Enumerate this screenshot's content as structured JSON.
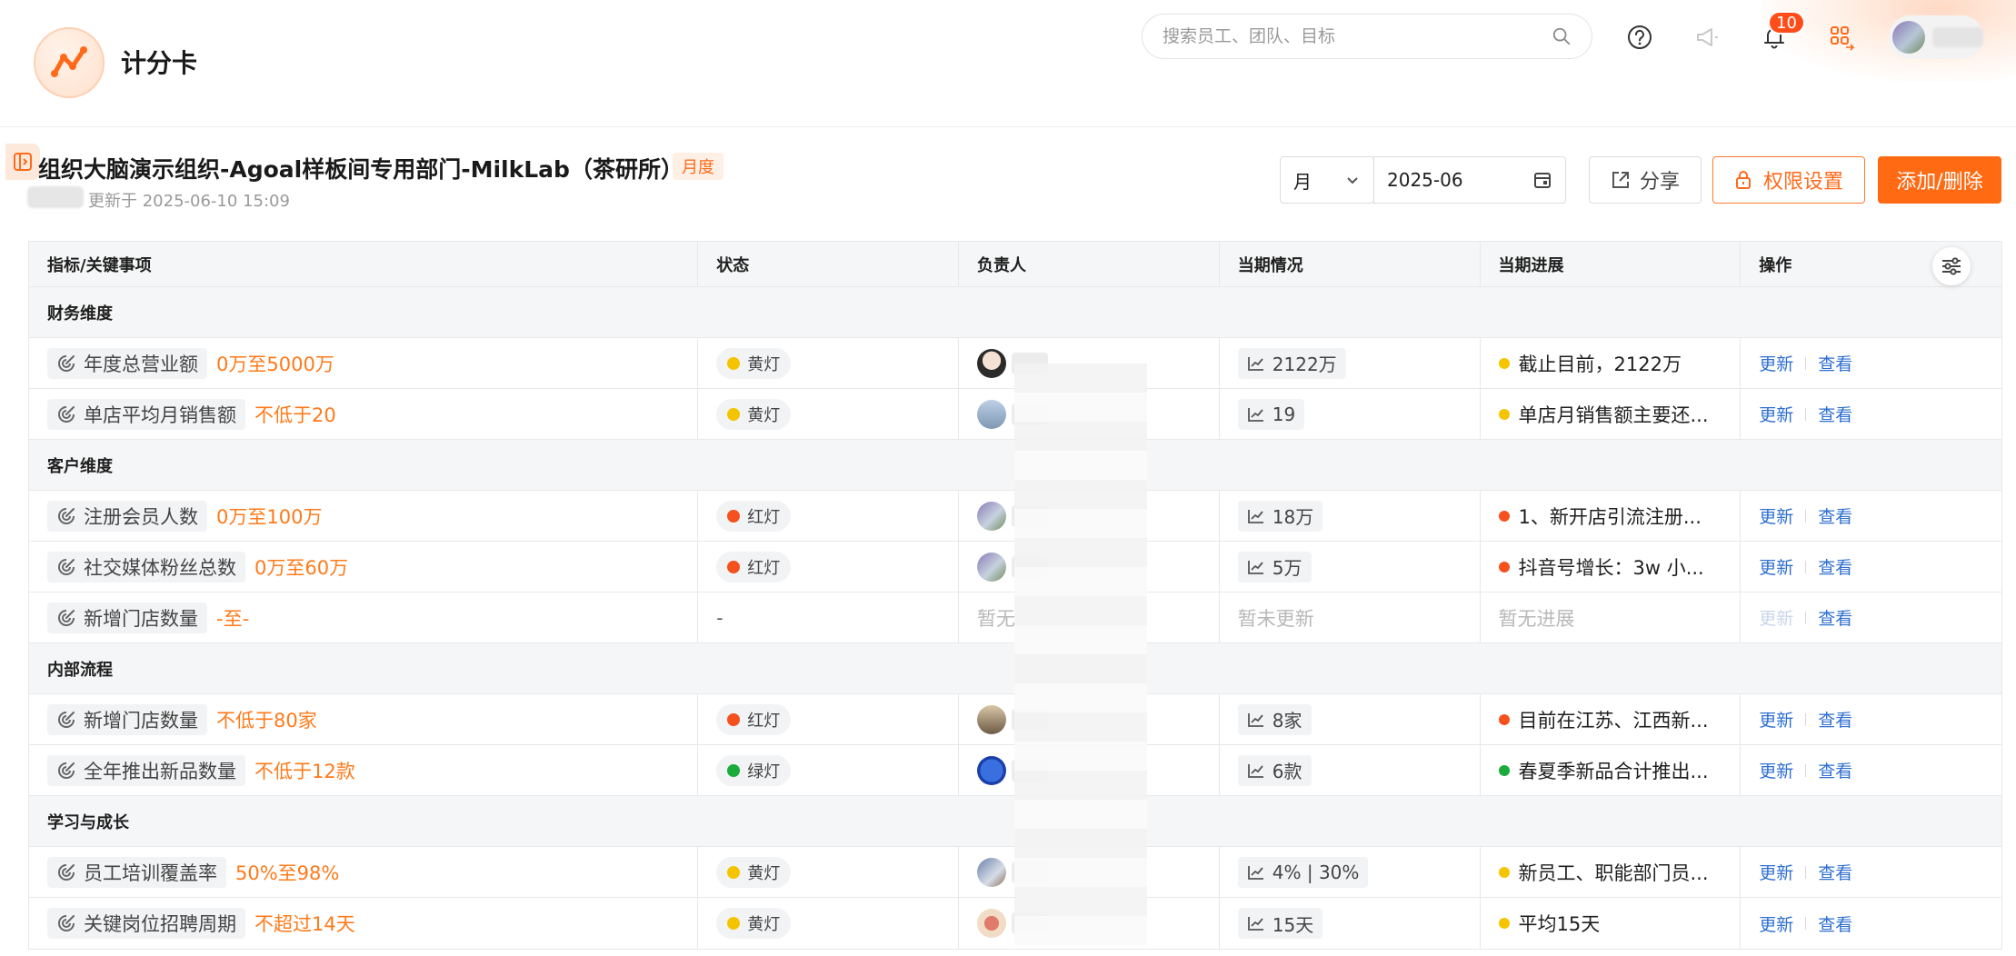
{
  "app": {
    "title": "计分卡"
  },
  "search": {
    "placeholder": "搜索员工、团队、目标"
  },
  "header": {
    "notification_count": "10",
    "icons": [
      "help-icon",
      "announcement-icon",
      "bell-icon",
      "app-switcher-icon"
    ]
  },
  "page": {
    "title": "组织大脑演示组织-Agoal样板间专用部门-MilkLab（茶研所）",
    "period_tag": "月度",
    "updated": "更新于 2025-06-10 15:09"
  },
  "controls": {
    "period_select": "月",
    "date": "2025-06",
    "share": "分享",
    "permissions": "权限设置",
    "add_remove": "添加/删除"
  },
  "table": {
    "columns": [
      "指标/关键事项",
      "状态",
      "负责人",
      "当期情况",
      "当期进展",
      "操作"
    ],
    "actions": {
      "update": "更新",
      "view": "查看"
    },
    "groups": [
      {
        "title": "财务维度",
        "rows": [
          {
            "metric": "年度总营业额",
            "target": "0万至5000万",
            "status": "黄灯",
            "status_color": "#f5c400",
            "value": "2122万",
            "progress": "截止目前，2122万",
            "progress_color": "#f5c400"
          },
          {
            "metric": "单店平均月销售额",
            "target": "不低于20",
            "status": "黄灯",
            "status_color": "#f5c400",
            "value": "19",
            "progress": "单店月销售额主要还...",
            "progress_color": "#f5c400"
          }
        ]
      },
      {
        "title": "客户维度",
        "rows": [
          {
            "metric": "注册会员人数",
            "target": "0万至100万",
            "status": "红灯",
            "status_color": "#f4511e",
            "value": "18万",
            "progress": "1、新开店引流注册...",
            "progress_color": "#f4511e"
          },
          {
            "metric": "社交媒体粉丝总数",
            "target": "0万至60万",
            "status": "红灯",
            "status_color": "#f4511e",
            "value": "5万",
            "progress": "抖音号增长：3w 小...",
            "progress_color": "#f4511e"
          },
          {
            "metric": "新增门店数量",
            "target": "-至-",
            "status": "-",
            "status_color": "",
            "owner_empty": "暂无",
            "value_empty": "暂未更新",
            "progress_empty": "暂无进展"
          }
        ]
      },
      {
        "title": "内部流程",
        "rows": [
          {
            "metric": "新增门店数量",
            "target": "不低于80家",
            "status": "红灯",
            "status_color": "#f4511e",
            "value": "8家",
            "progress": "目前在江苏、江西新...",
            "progress_color": "#f4511e"
          },
          {
            "metric": "全年推出新品数量",
            "target": "不低于12款",
            "status": "绿灯",
            "status_color": "#1aab3a",
            "value": "6款",
            "progress": "春夏季新品合计推出...",
            "progress_color": "#1aab3a"
          }
        ]
      },
      {
        "title": "学习与成长",
        "rows": [
          {
            "metric": "员工培训覆盖率",
            "target": "50%至98%",
            "status": "黄灯",
            "status_color": "#f5c400",
            "value": "4% | 30%",
            "progress": "新员工、职能部门员...",
            "progress_color": "#f5c400"
          },
          {
            "metric": "关键岗位招聘周期",
            "target": "不超过14天",
            "status": "黄灯",
            "status_color": "#f5c400",
            "value": "15天",
            "progress": "平均15天",
            "progress_color": "#f5c400"
          }
        ]
      }
    ]
  }
}
